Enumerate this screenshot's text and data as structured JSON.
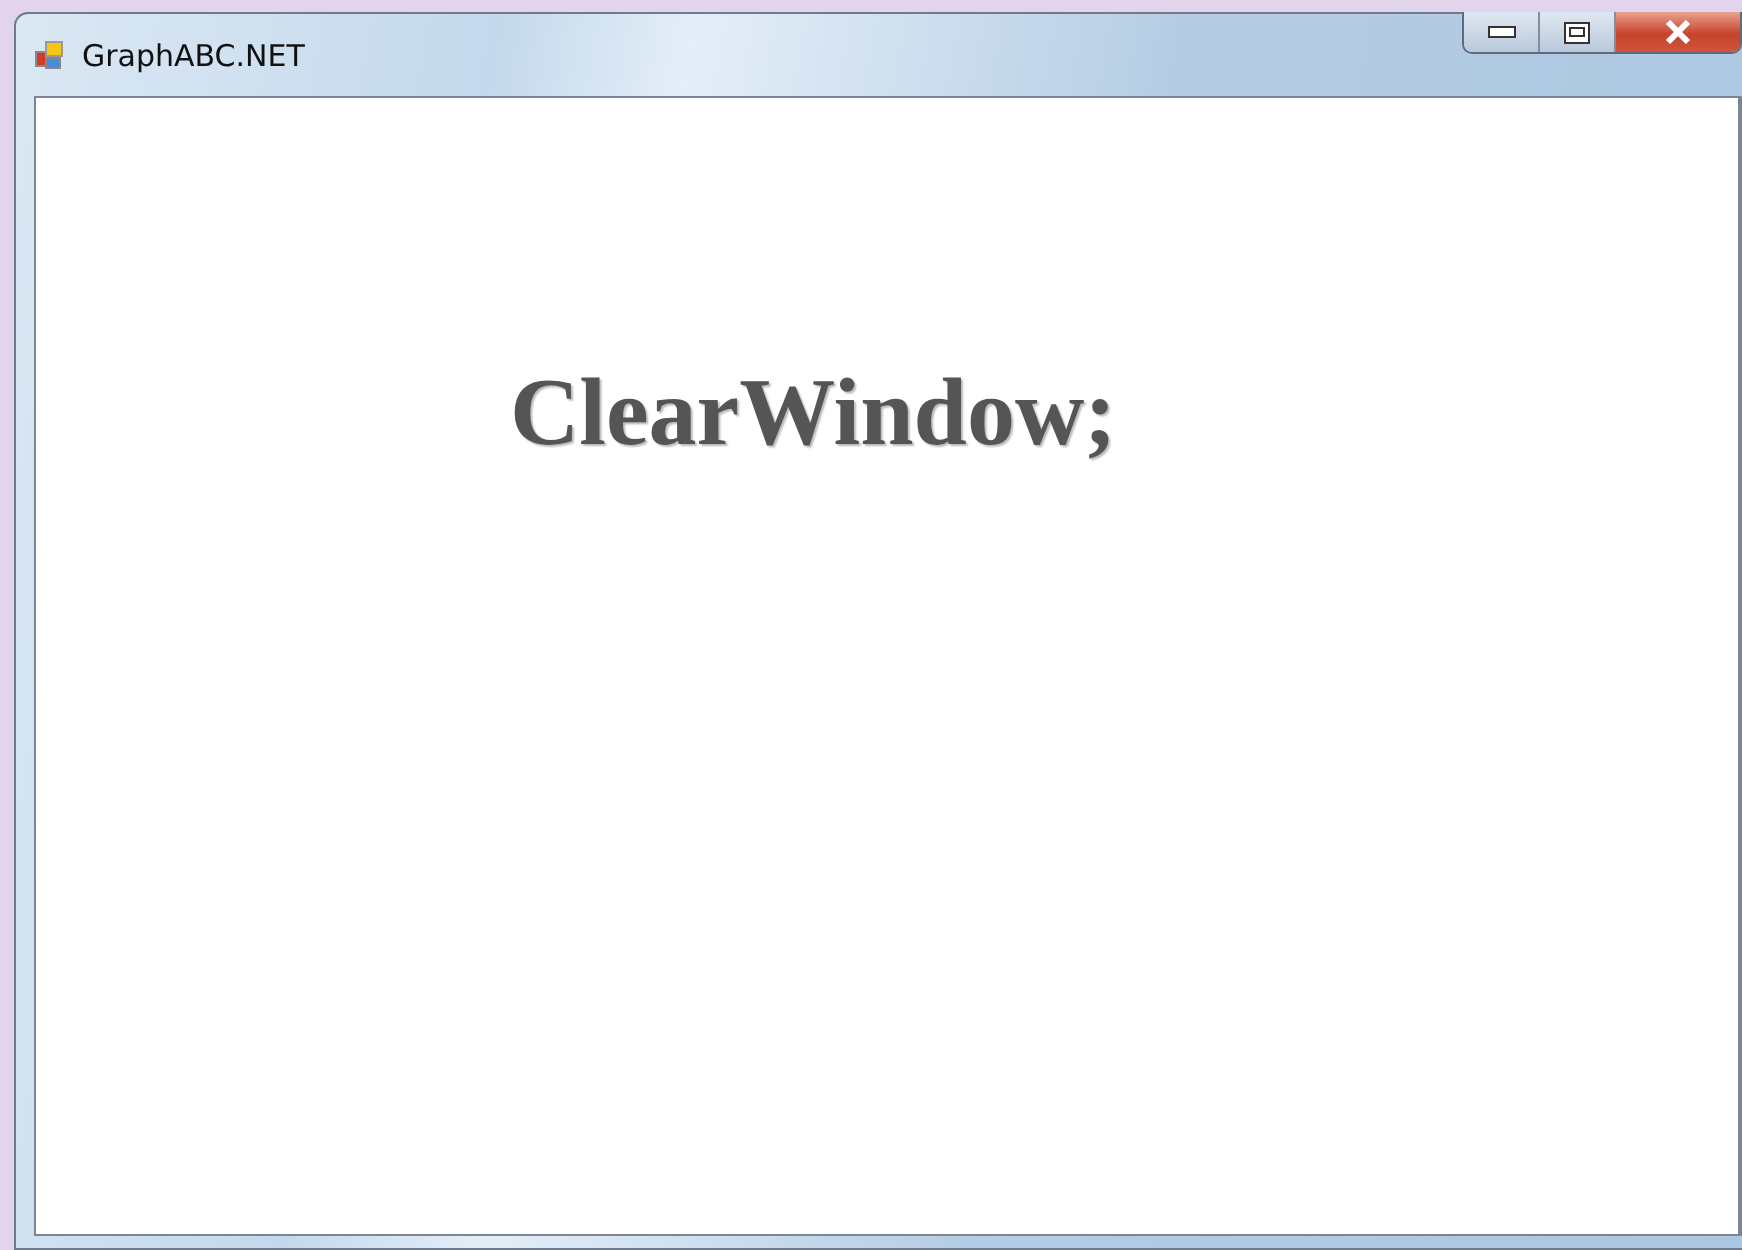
{
  "window": {
    "title": "GraphABC.NET"
  },
  "canvas": {
    "text": "ClearWindow;"
  }
}
